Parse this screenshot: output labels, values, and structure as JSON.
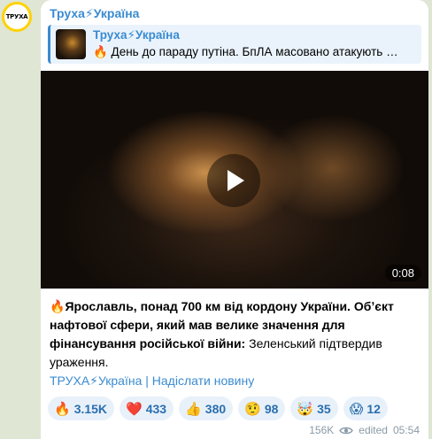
{
  "avatar_text": "ТРУХА",
  "channel": {
    "name": "Труха⚡Україна"
  },
  "reply": {
    "title": "Труха⚡Україна",
    "text": "🔥 День до параду путіна. БпЛА масовано атакують …"
  },
  "video": {
    "duration": "0:08"
  },
  "message": {
    "emoji": "🔥",
    "bold_text": "Ярославль, понад 700 км від кордону України. Обʼєкт нафтової сфери, який мав велике значення для фінансування російської війни:",
    "plain_text": " Зеленський підтвердив ураження."
  },
  "links": {
    "channel_link": "ТРУХА⚡Україна",
    "separator": " | ",
    "submit_link": "Надіслати новину"
  },
  "reactions": [
    {
      "emoji": "🔥",
      "count": "3.15K"
    },
    {
      "emoji": "❤️",
      "count": "433"
    },
    {
      "emoji": "👍",
      "count": "380"
    },
    {
      "emoji": "🤨",
      "count": "98"
    },
    {
      "emoji": "🤯",
      "count": "35"
    },
    {
      "emoji": "😱",
      "count": "12"
    }
  ],
  "meta": {
    "views": "156K",
    "edited": "edited",
    "time": "05:54"
  }
}
